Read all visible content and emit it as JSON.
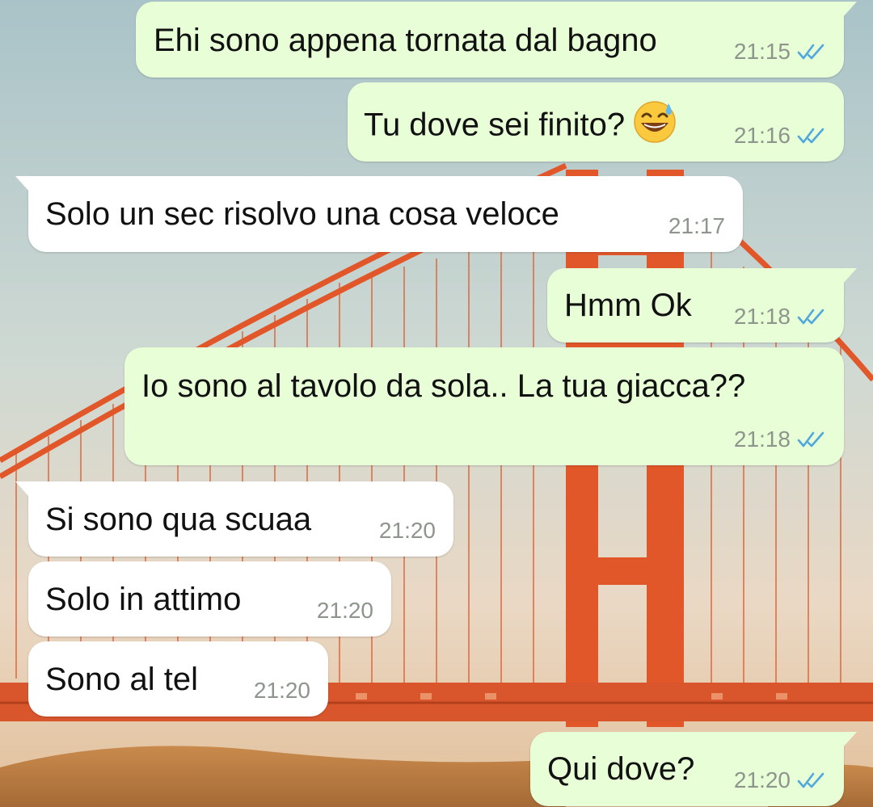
{
  "colors": {
    "outgoing_bubble": "#e7fed6",
    "incoming_bubble": "#ffffff",
    "read_ticks": "#4fa8de",
    "timestamp": "#8e958d",
    "bridge_orange": "#e2572a"
  },
  "wallpaper": {
    "subject": "golden-gate-bridge"
  },
  "messages": [
    {
      "direction": "outgoing",
      "text": "Ehi sono appena tornata dal bagno",
      "time": "21:15",
      "status": "read-double-check-icon"
    },
    {
      "direction": "outgoing",
      "text": "Tu dove sei finito?",
      "emoji": "grinning-sweat-emoji",
      "time": "21:16",
      "status": "read-double-check-icon"
    },
    {
      "direction": "incoming",
      "text": "Solo un sec risolvo una cosa veloce",
      "time": "21:17"
    },
    {
      "direction": "outgoing",
      "text": "Hmm Ok",
      "time": "21:18",
      "status": "read-double-check-icon"
    },
    {
      "direction": "outgoing",
      "text": "Io sono al tavolo da sola.. La tua giacca??",
      "time": "21:18",
      "status": "read-double-check-icon"
    },
    {
      "direction": "incoming",
      "text": "Si sono qua scuaa",
      "time": "21:20"
    },
    {
      "direction": "incoming",
      "text": "Solo in attimo",
      "time": "21:20"
    },
    {
      "direction": "incoming",
      "text": "Sono al tel",
      "time": "21:20"
    },
    {
      "direction": "outgoing",
      "text": "Qui dove?",
      "time": "21:20",
      "status": "read-double-check-icon"
    }
  ]
}
